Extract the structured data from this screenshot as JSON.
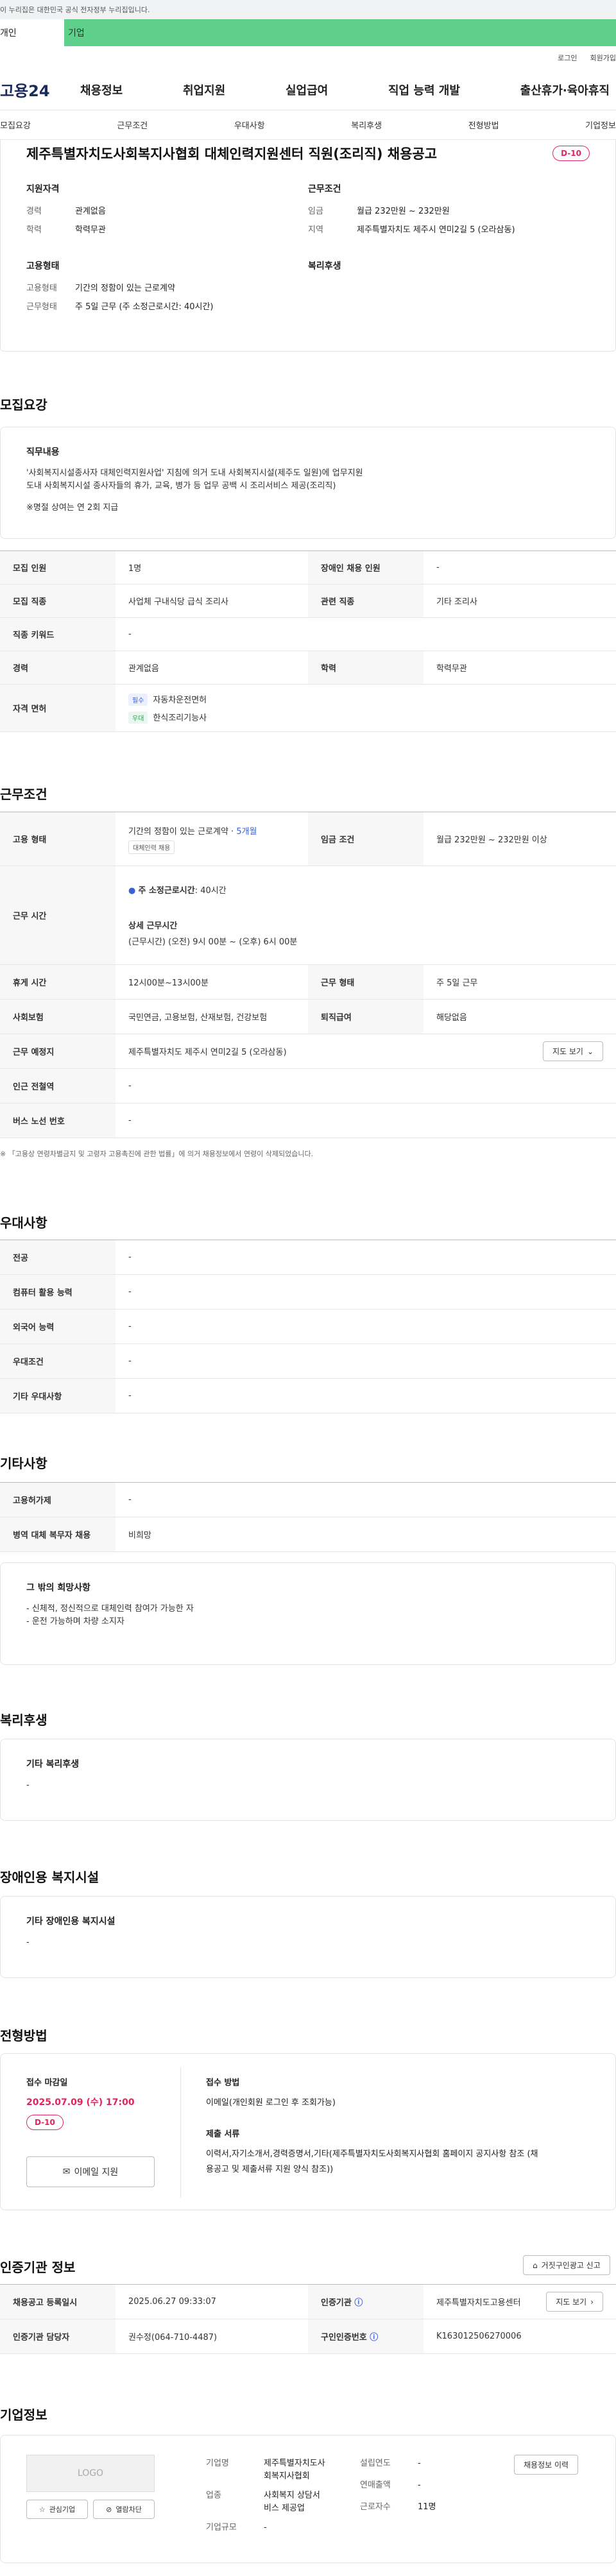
{
  "gov_notice": "이 누리집은 대한민국 공식 전자정부 누리집입니다.",
  "type_tabs": {
    "individual": "개인",
    "enterprise": "기업"
  },
  "util": {
    "login": "로그인",
    "signup": "회원가입"
  },
  "logo": "고용24",
  "gnb": [
    "채용정보",
    "취업지원",
    "실업급여",
    "직업 능력 개발",
    "출산휴가·육아휴직"
  ],
  "tabs": [
    "모집요강",
    "근무조건",
    "우대사항",
    "복리후생",
    "전형방법",
    "기업정보"
  ],
  "job": {
    "title": "제주특별자치도사회복지사협회 대체인력지원센터 직원(조리직) 채용공고",
    "dday": "D-10",
    "summary": {
      "qual_title": "지원자격",
      "career_k": "경력",
      "career_v": "관계없음",
      "edu_k": "학력",
      "edu_v": "학력무관",
      "cond_title": "근무조건",
      "wage_k": "임금",
      "wage_v": "월급 232만원 ~ 232만원",
      "region_k": "지역",
      "region_v": "제주특별자치도 제주시 연미2길 5 (오라삼동)",
      "emp_title": "고용형태",
      "emptype_k": "고용형태",
      "emptype_v": "기간의 정함이 있는 근로계약",
      "worktype_k": "근무형태",
      "worktype_v": "주 5일 근무 (주 소정근로시간: 40시간)",
      "welfare_title": "복리후생"
    }
  },
  "recruit": {
    "heading": "모집요강",
    "duty_title": "직무내용",
    "duty_line1": "'사회복지시설종사자 대체인력지원사업' 지침에 의거 도내 사회복지시설(제주도 일원)에 업무지원",
    "duty_line2": "도내 사회복지시설 종사자들의 휴가, 교육, 병가 등 업무 공백 시 조리서비스 제공(조리직)",
    "duty_line3": "※명절 상여는 연 2회 지급",
    "rows": {
      "count_k": "모집 인원",
      "count_v": "1명",
      "disabled_k": "장애인 채용 인원",
      "disabled_v": "-",
      "job_k": "모집 직종",
      "job_v": "사업체 구내식당 급식 조리사",
      "related_k": "관련 직종",
      "related_v": "기타 조리사",
      "keyword_k": "직종 키워드",
      "keyword_v": "-",
      "career_k": "경력",
      "career_v": "관계없음",
      "edu_k": "학력",
      "edu_v": "학력무관",
      "license_k": "자격 면허",
      "license_tag1": "필수",
      "license_v1": "자동차운전면허",
      "license_tag2": "우대",
      "license_v2": "한식조리기능사"
    }
  },
  "conditions": {
    "heading": "근무조건",
    "emptype_k": "고용 형태",
    "emptype_v": "기간의 정함이 있는 근로계약 · ",
    "emptype_months": "5개월",
    "emptype_chip": "대체인력 채용",
    "wage_k": "임금 조건",
    "wage_v": "월급 232만원 ~ 232만원 이상",
    "hours_k": "근무 시간",
    "hours_weekly_label": "주 소정근로시간",
    "hours_weekly_v": ": 40시간",
    "hours_detail_label": "상세 근무시간",
    "hours_detail_v": "(근무시간) (오전) 9시 00분 ~ (오후) 6시 00분",
    "break_k": "휴게 시간",
    "break_v": "12시00분~13시00분",
    "workform_k": "근무 형태",
    "workform_v": "주 5일 근무",
    "insurance_k": "사회보험",
    "insurance_v": "국민연금, 고용보험, 산재보험, 건강보험",
    "severance_k": "퇴직급여",
    "severance_v": "해당없음",
    "place_k": "근무 예정지",
    "place_v": "제주특별자치도 제주시 연미2길 5 (오라삼동)",
    "map_btn": "지도 보기",
    "subway_k": "인근 전철역",
    "subway_v": "-",
    "bus_k": "버스 노선 번호",
    "bus_v": "-",
    "footnote": "※ 「고용상 연령차별금지 및 고령자 고용촉진에 관한 법률」에 의거 채용정보에서 연령이 삭제되었습니다."
  },
  "preferences": {
    "heading": "우대사항",
    "major_k": "전공",
    "major_v": "-",
    "pc_k": "컴퓨터 활용 능력",
    "pc_v": "-",
    "lang_k": "외국어 능력",
    "lang_v": "-",
    "cond_k": "우대조건",
    "cond_v": "-",
    "etc_k": "기타 우대사항",
    "etc_v": "-"
  },
  "others": {
    "heading": "기타사항",
    "facility_k": "고용허가제",
    "facility_v": "-",
    "military_k": "병역 대체 복무자 채용",
    "military_v": "비희망",
    "wish_title": "그 밖의 희망사항",
    "wish1": "- 신체적, 정신적으로 대체인력 참여가 가능한 자",
    "wish2": "- 운전 가능하며 차량 소지자"
  },
  "welfare": {
    "heading": "복리후생",
    "etc_title": "기타 복리후생",
    "etc_v": "-"
  },
  "disabled_facility": {
    "heading": "장애인용 복지시설",
    "etc_title": "기타 장애인용 복지시설",
    "etc_v": "-"
  },
  "process": {
    "heading": "전형방법",
    "deadline_label": "접수 마감일",
    "deadline_v": "2025.07.09 (수) 17:00",
    "dday": "D-10",
    "email_btn": "이메일 지원",
    "method_label": "접수 방법",
    "method_v": "이메일(개인회원 로그인 후 조회가능)",
    "docs_label": "제출 서류",
    "docs_v1": "이력서,자기소개서,경력증명서,기타(제주특별자치도사회복지사협회 홈페이지 공지사항 참조 (채",
    "docs_v2": "용공고 및 제출서류 지원 양식 참조))"
  },
  "agency": {
    "heading": "인증기관 정보",
    "report_btn": "거짓구인광고 신고",
    "reg_k": "채용공고 등록일시",
    "reg_v": "2025.06.27 09:33:07",
    "agency_k": "인증기관",
    "agency_v": "제주특별자치도고용센터",
    "map_btn": "지도 보기",
    "manager_k": "인증기관 담당자",
    "manager_v": "권수정(064-710-4487)",
    "reqno_k": "구인인증번호",
    "reqno_v": "K163012506270006"
  },
  "company": {
    "heading": "기업정보",
    "logo_placeholder": "LOGO",
    "fav_btn": "관심기업",
    "block_btn": "열람차단",
    "name_k": "기업명",
    "name_v1": "제주특별자치도사",
    "name_v2": "회복지사협회",
    "industry_k": "업종",
    "industry_v1": "사회복지 상담서",
    "industry_v2": "비스 제공업",
    "scale_k": "기업규모",
    "scale_v": "-",
    "founded_k": "설립연도",
    "founded_v": "-",
    "sales_k": "연매출액",
    "sales_v": "-",
    "employees_k": "근로자수",
    "employees_v": "11명",
    "more_btn": "채용정보 이력"
  }
}
